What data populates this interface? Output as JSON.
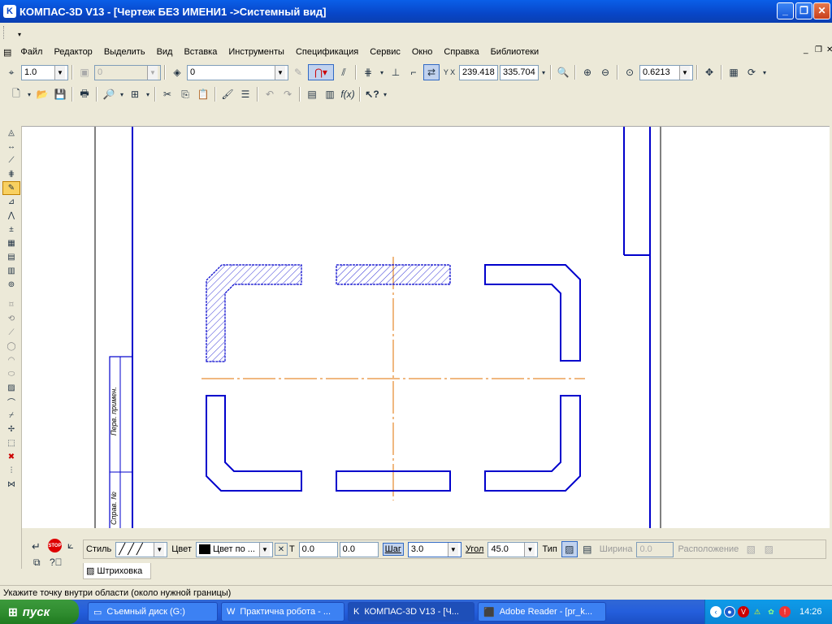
{
  "window": {
    "title": "КОМПАС-3D V13 - [Чертеж БЕЗ ИМЕНИ1 ->Системный вид]"
  },
  "menu": [
    "Файл",
    "Редактор",
    "Выделить",
    "Вид",
    "Вставка",
    "Инструменты",
    "Спецификация",
    "Сервис",
    "Окно",
    "Справка",
    "Библиотеки"
  ],
  "toolbar1": {
    "line_scale": "1.0",
    "layer_num": "0",
    "layer_name": "0",
    "coord_x": "239.418",
    "coord_y": "335.704",
    "zoom": "0.6213",
    "coord_label": "Y X"
  },
  "drawing": {
    "rotated_text_1": "Перв. примен.",
    "rotated_text_2": "Справ. №"
  },
  "props": {
    "style_label": "Стиль",
    "color_label": "Цвет",
    "color_value": "Цвет по ...",
    "x_label": "T",
    "x_value": "0.0",
    "y_value": "0.0",
    "step_label": "Шаг",
    "step_value": "3.0",
    "angle_label": "Угол",
    "angle_value": "45.0",
    "type_label": "Тип",
    "width_label": "Ширина",
    "width_value": "0.0",
    "layout_label": "Расположение",
    "tab_label": "Штриховка"
  },
  "status": {
    "hint": "Укажите точку внутри области (около нужной границы)"
  },
  "taskbar": {
    "start": "пуск",
    "items": [
      "Съемный диск (G:)",
      "Практична робота - ...",
      "КОМПАС-3D V13 - [Ч...",
      "Adobe Reader - [pr_k..."
    ],
    "clock": "14:26"
  },
  "colors": {
    "drawing_line": "#0000cc",
    "axis_line": "#e07000",
    "hatch": "#0000cc",
    "selection": "#316ac5"
  }
}
